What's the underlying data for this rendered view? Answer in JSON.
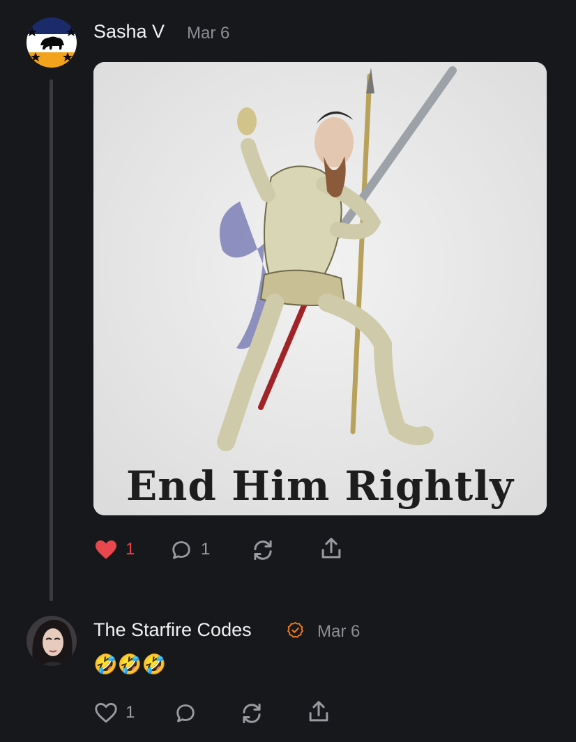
{
  "post": {
    "author": "Sasha V",
    "date": "Mar 6",
    "image_caption": "End Him Rightly",
    "likes": "1",
    "comments": "1",
    "liked": true
  },
  "reply": {
    "author": "The Starfire Codes",
    "verified": true,
    "date": "Mar 6",
    "text": "🤣🤣🤣",
    "likes": "1"
  },
  "colors": {
    "background": "#17181b",
    "like_active": "#e8474d",
    "verified_badge": "#f07c1c",
    "muted": "#8d8e93"
  },
  "icons": [
    "heart-icon",
    "comment-icon",
    "restack-icon",
    "share-icon",
    "verified-icon"
  ]
}
